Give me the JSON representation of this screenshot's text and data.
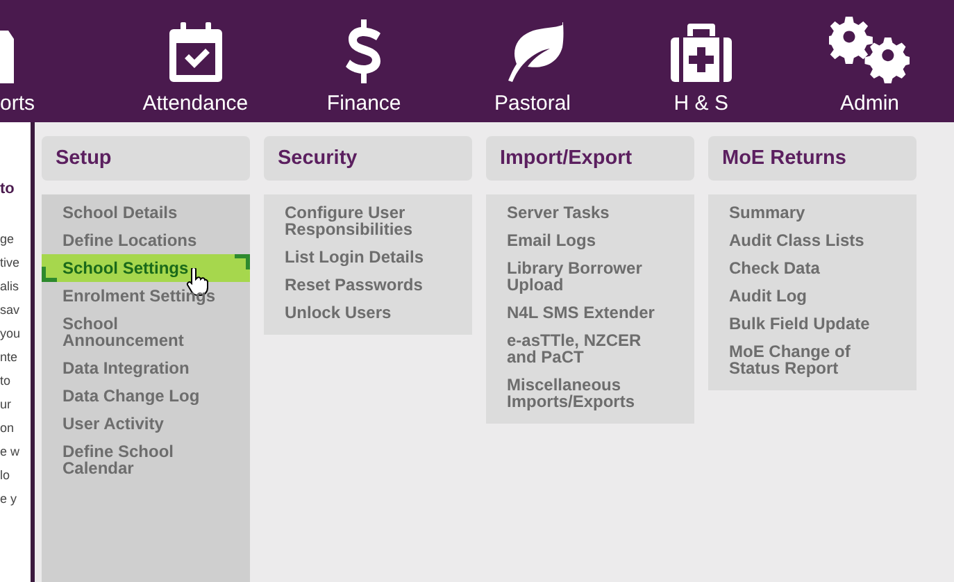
{
  "nav": [
    {
      "label": "orts"
    },
    {
      "label": "Attendance"
    },
    {
      "label": "Finance"
    },
    {
      "label": "Pastoral"
    },
    {
      "label": "H & S"
    },
    {
      "label": "Admin"
    }
  ],
  "background_page": {
    "heading": "to",
    "lines": [
      "ge",
      "tive",
      "alis",
      "sav",
      "you",
      "nte",
      "to",
      "ur",
      "on",
      "e w",
      "lo",
      "e y"
    ]
  },
  "menu": [
    {
      "title": "Setup",
      "items": [
        {
          "label": "School Details",
          "selected": false
        },
        {
          "label": "Define Locations",
          "selected": false
        },
        {
          "label": "School Settings",
          "selected": true
        },
        {
          "label": "Enrolment Settings",
          "selected": false
        },
        {
          "label": "School Announcement",
          "selected": false
        },
        {
          "label": "Data Integration",
          "selected": false
        },
        {
          "label": "Data Change Log",
          "selected": false
        },
        {
          "label": "User Activity",
          "selected": false
        },
        {
          "label": "Define School Calendar",
          "selected": false
        }
      ]
    },
    {
      "title": "Security",
      "items": [
        {
          "label": "Configure User Responsibilities",
          "selected": false
        },
        {
          "label": "List Login Details",
          "selected": false
        },
        {
          "label": "Reset Passwords",
          "selected": false
        },
        {
          "label": "Unlock Users",
          "selected": false
        }
      ]
    },
    {
      "title": "Import/Export",
      "items": [
        {
          "label": "Server Tasks",
          "selected": false
        },
        {
          "label": "Email Logs",
          "selected": false
        },
        {
          "label": "Library Borrower Upload",
          "selected": false
        },
        {
          "label": "N4L SMS Extender",
          "selected": false
        },
        {
          "label": "e-asTTle, NZCER and PaCT",
          "selected": false
        },
        {
          "label": "Miscellaneous Imports/Exports",
          "selected": false
        }
      ]
    },
    {
      "title": "MoE Returns",
      "items": [
        {
          "label": "Summary",
          "selected": false
        },
        {
          "label": "Audit Class Lists",
          "selected": false
        },
        {
          "label": "Check Data",
          "selected": false
        },
        {
          "label": "Audit Log",
          "selected": false
        },
        {
          "label": "Bulk Field Update",
          "selected": false
        },
        {
          "label": "MoE Change of Status Report",
          "selected": false
        }
      ]
    }
  ]
}
